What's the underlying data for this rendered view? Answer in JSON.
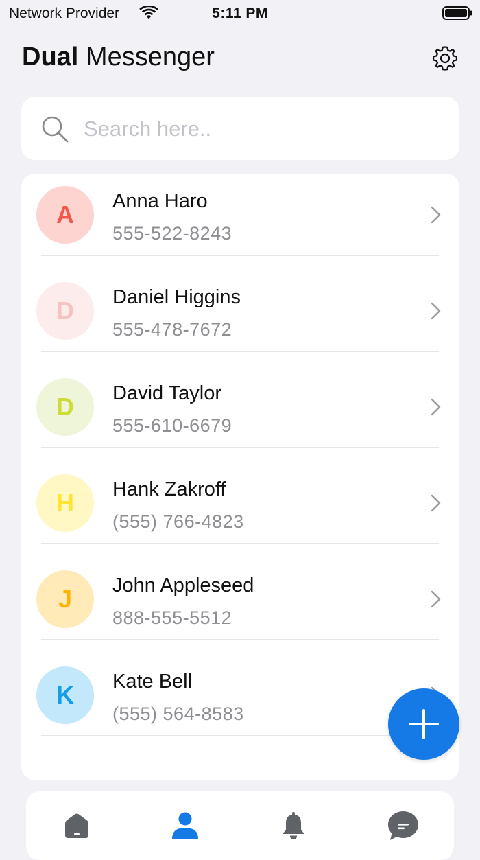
{
  "status_bar": {
    "carrier": "Network Provider",
    "time": "5:11 PM"
  },
  "header": {
    "title_bold": "Dual",
    "title_regular": " Messenger",
    "settings_icon": "gear-icon"
  },
  "search": {
    "placeholder": "Search here..",
    "value": ""
  },
  "contacts": [
    {
      "initial": "A",
      "name": "Anna Haro",
      "phone": "555-522-8243",
      "bg": "#fdd4d0",
      "fg": "#f2584a"
    },
    {
      "initial": "D",
      "name": "Daniel Higgins",
      "phone": "555-478-7672",
      "bg": "#fdecec",
      "fg": "#f7c2c2"
    },
    {
      "initial": "D",
      "name": "David Taylor",
      "phone": "555-610-6679",
      "bg": "#eff5d8",
      "fg": "#cddc39"
    },
    {
      "initial": "H",
      "name": "Hank Zakroff",
      "phone": "(555) 766-4823",
      "bg": "#fff8c4",
      "fg": "#ffe433"
    },
    {
      "initial": "J",
      "name": "John Appleseed",
      "phone": "888-555-5512",
      "bg": "#ffeab8",
      "fg": "#ffb300"
    },
    {
      "initial": "K",
      "name": "Kate Bell",
      "phone": "(555) 564-8583",
      "bg": "#c3e7fb",
      "fg": "#139ee5"
    }
  ],
  "colors": {
    "accent": "#1579e6",
    "background": "#f1f1f6",
    "tab_inactive": "#5f6368"
  },
  "tab_bar": {
    "tabs": [
      {
        "icon": "home-icon",
        "active": false
      },
      {
        "icon": "person-icon",
        "active": true
      },
      {
        "icon": "bell-icon",
        "active": false
      },
      {
        "icon": "chat-icon",
        "active": false
      }
    ]
  },
  "fab": {
    "icon": "plus-icon"
  }
}
